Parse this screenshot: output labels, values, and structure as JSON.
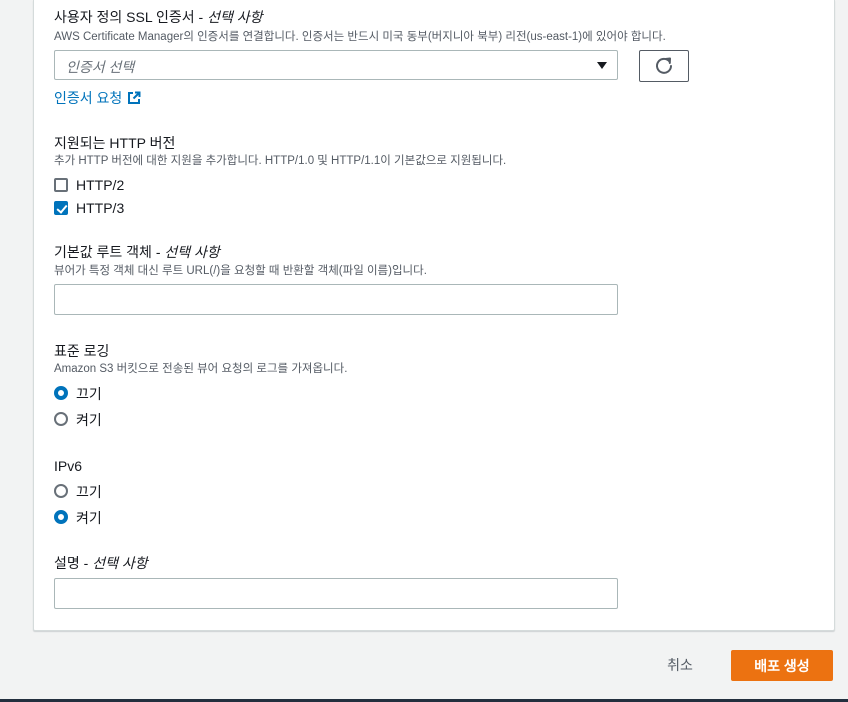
{
  "ssl": {
    "label": "사용자 정의 SSL 인증서",
    "optional": "선택 사항",
    "description": "AWS Certificate Manager의 인증서를 연결합니다. 인증서는 반드시 미국 동부(버지니아 북부) 리전(us-east-1)에 있어야 합니다.",
    "select_placeholder": "인증서 선택",
    "request_link": "인증서 요청"
  },
  "http": {
    "label": "지원되는 HTTP 버전",
    "description": "추가 HTTP 버전에 대한 지원을 추가합니다. HTTP/1.0 및 HTTP/1.1이 기본값으로 지원됩니다.",
    "options": [
      {
        "label": "HTTP/2",
        "checked": false
      },
      {
        "label": "HTTP/3",
        "checked": true
      }
    ]
  },
  "root_object": {
    "label": "기본값 루트 객체",
    "optional": "선택 사항",
    "description": "뷰어가 특정 객체 대신 루트 URL(/)을 요청할 때 반환할 객체(파일 이름)입니다.",
    "value": ""
  },
  "logging": {
    "label": "표준 로깅",
    "description": "Amazon S3 버킷으로 전송된 뷰어 요청의 로그를 가져옵니다.",
    "options": [
      {
        "label": "끄기",
        "selected": true
      },
      {
        "label": "켜기",
        "selected": false
      }
    ]
  },
  "ipv6": {
    "label": "IPv6",
    "options": [
      {
        "label": "끄기",
        "selected": false
      },
      {
        "label": "켜기",
        "selected": true
      }
    ]
  },
  "description_field": {
    "label": "설명",
    "optional": "선택 사항",
    "value": ""
  },
  "footer": {
    "cancel_label": "취소",
    "create_label": "배포 생성"
  },
  "colors": {
    "accent": "#0073bb",
    "primary_button": "#ec7211",
    "link": "#0073bb"
  },
  "icons": {
    "refresh": "refresh-icon",
    "external_link": "external-link-icon",
    "dropdown": "caret-down-icon"
  }
}
